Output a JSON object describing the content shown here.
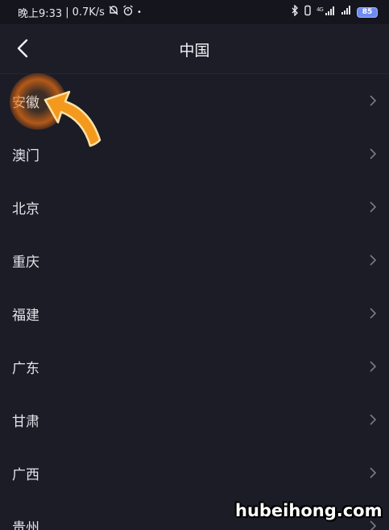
{
  "status_bar": {
    "time": "晚上9:33",
    "divider": "|",
    "speed": "0.7K/s",
    "network": "4G",
    "battery": "85"
  },
  "header": {
    "title": "中国"
  },
  "list": {
    "items": [
      {
        "label": "安徽"
      },
      {
        "label": "澳门"
      },
      {
        "label": "北京"
      },
      {
        "label": "重庆"
      },
      {
        "label": "福建"
      },
      {
        "label": "广东"
      },
      {
        "label": "甘肃"
      },
      {
        "label": "广西"
      },
      {
        "label": "贵州"
      }
    ]
  },
  "watermark": "hubeihong.com",
  "colors": {
    "background": "#1b1c26",
    "highlight": "#e8781e",
    "battery": "#6e8cf0"
  },
  "icons": {
    "back": "chevron-left-icon",
    "row": "chevron-right-icon",
    "pointer": "arrow-icon"
  }
}
